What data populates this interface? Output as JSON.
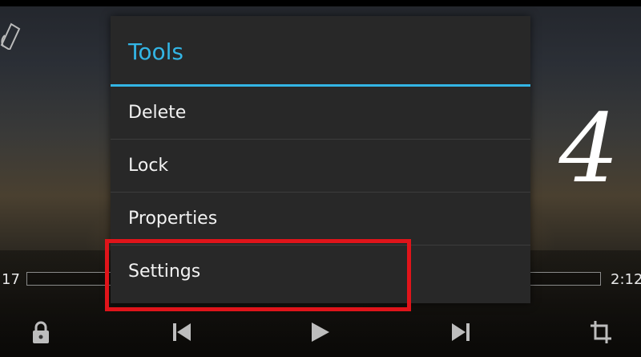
{
  "dialog": {
    "title": "Tools",
    "items": [
      {
        "label": "Delete"
      },
      {
        "label": "Lock"
      },
      {
        "label": "Properties"
      },
      {
        "label": "Settings"
      }
    ]
  },
  "player": {
    "time_elapsed": "17",
    "time_total": "2:12",
    "controls": [
      "lock-icon",
      "skip-previous-icon",
      "play-icon",
      "skip-next-icon",
      "crop-icon"
    ]
  },
  "overlay": {
    "step_number": "4",
    "highlight_color": "#e0141a"
  },
  "colors": {
    "accent": "#33b5e5",
    "dialog_bg": "#282828"
  }
}
